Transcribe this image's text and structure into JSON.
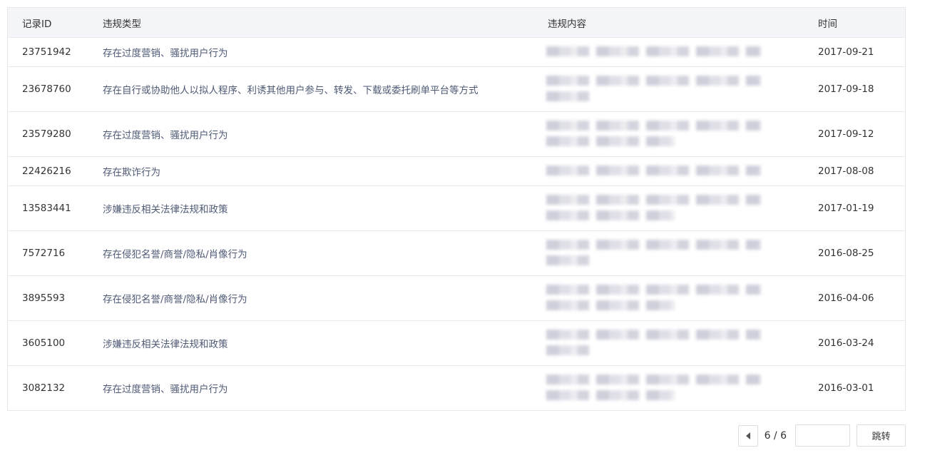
{
  "table": {
    "headers": {
      "id": "记录ID",
      "type": "违规类型",
      "content": "违规内容",
      "date": "时间"
    },
    "rows": [
      {
        "id": "23751942",
        "type": "存在过度营销、骚扰用户行为",
        "date": "2017-09-21",
        "lines": 1
      },
      {
        "id": "23678760",
        "type": "存在自行或协助他人以拟人程序、利诱其他用户参与、转发、下载或委托刷单平台等方式",
        "date": "2017-09-18",
        "lines": 2
      },
      {
        "id": "23579280",
        "type": "存在过度营销、骚扰用户行为",
        "date": "2017-09-12",
        "lines": 2
      },
      {
        "id": "22426216",
        "type": "存在欺诈行为",
        "date": "2017-08-08",
        "lines": 1
      },
      {
        "id": "13583441",
        "type": "涉嫌违反相关法律法规和政策",
        "date": "2017-01-19",
        "lines": 2
      },
      {
        "id": "7572716",
        "type": "存在侵犯名誉/商誉/隐私/肖像行为",
        "date": "2016-08-25",
        "lines": 2
      },
      {
        "id": "3895593",
        "type": "存在侵犯名誉/商誉/隐私/肖像行为",
        "date": "2016-04-06",
        "lines": 2
      },
      {
        "id": "3605100",
        "type": "涉嫌违反相关法律法规和政策",
        "date": "2016-03-24",
        "lines": 2
      },
      {
        "id": "3082132",
        "type": "存在过度营销、骚扰用户行为",
        "date": "2016-03-01",
        "lines": 2
      }
    ]
  },
  "pagination": {
    "info": "6 / 6",
    "input_value": "",
    "go_label": "跳转"
  }
}
